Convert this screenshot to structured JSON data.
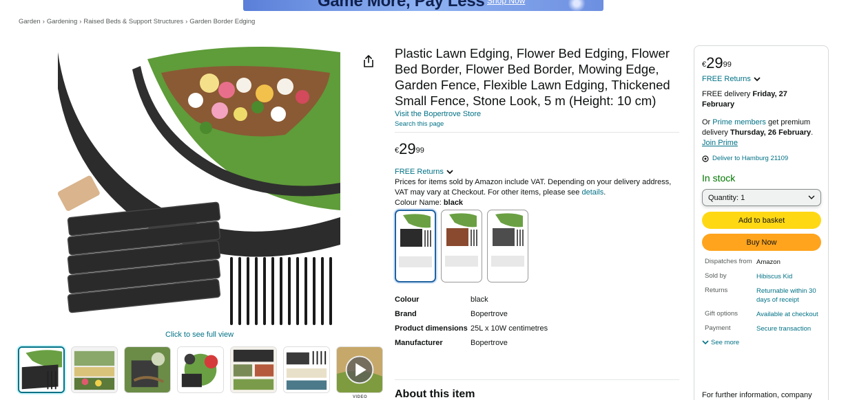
{
  "ad_banner": {
    "text": "Game More, Pay Less",
    "link": "Shop Now"
  },
  "breadcrumb": [
    "Garden",
    "Gardening",
    "Raised Beds & Support Structures",
    "Garden Border Edging"
  ],
  "breadcrumb_separator": "›",
  "gallery": {
    "click_full_view": "Click to see full view",
    "video_label": "VIDEO",
    "thumbnail_count": 7,
    "selected_index": 0
  },
  "product": {
    "title": "Plastic Lawn Edging, Flower Bed Edging, Flower Bed Border, Flower Bed Border, Mowing Edge, Garden Fence, Flexible Lawn Edging, Thickened Small Fence, Stone Look, 5 m (Height: 10 cm)",
    "store_link": "Visit the Bopertrove Store",
    "search_page": "Search this page",
    "price": {
      "currency": "€",
      "whole": "29",
      "fraction": "99"
    },
    "free_returns": "FREE Returns",
    "vat_note_before": "Prices for items sold by Amazon include VAT. Depending on your delivery address, VAT may vary at Checkout. For other items, please see",
    "vat_note_link": "details",
    "vat_note_after": ".",
    "colour_label": "Colour Name:",
    "colour_value": "black",
    "swatch_colors": [
      "#2b2b2b",
      "#8a4a2f",
      "#4d4d4d"
    ],
    "specs": [
      {
        "key": "Colour",
        "value": "black"
      },
      {
        "key": "Brand",
        "value": "Bopertrove"
      },
      {
        "key": "Product dimensions",
        "value": "25L x 10W centimetres"
      },
      {
        "key": "Manufacturer",
        "value": "Bopertrove"
      }
    ],
    "about_heading": "About this item"
  },
  "buybox": {
    "price": {
      "currency": "€",
      "whole": "29",
      "fraction": "99"
    },
    "free_returns": "FREE Returns",
    "delivery_prefix": "FREE delivery",
    "delivery_date": "Friday, 27 February",
    "prime_prefix": "Or",
    "prime_members": "Prime members",
    "prime_middle": "get premium delivery",
    "prime_date": "Thursday, 26 February",
    "prime_end": ".",
    "join_prime": "Join Prime",
    "deliver_to": "Deliver to Hamburg 21109",
    "stock": "In stock",
    "quantity_label": "Quantity: 1",
    "add_to_basket": "Add to basket",
    "buy_now": "Buy Now",
    "info": [
      {
        "key": "Dispatches from",
        "value": "Amazon",
        "link": false
      },
      {
        "key": "Sold by",
        "value": "Hibiscus Kid",
        "link": true
      },
      {
        "key": "Returns",
        "value": "Returnable within 30 days of receipt",
        "link": true
      },
      {
        "key": "Gift options",
        "value": "Available at checkout",
        "link": true
      },
      {
        "key": "Payment",
        "value": "Secure transaction",
        "link": true
      }
    ],
    "see_more": "See more",
    "further_info": "For further information, company"
  },
  "colors": {
    "link": "#007185",
    "add_to_basket": "#ffd814",
    "buy_now": "#ffa41c",
    "in_stock": "#007600"
  }
}
